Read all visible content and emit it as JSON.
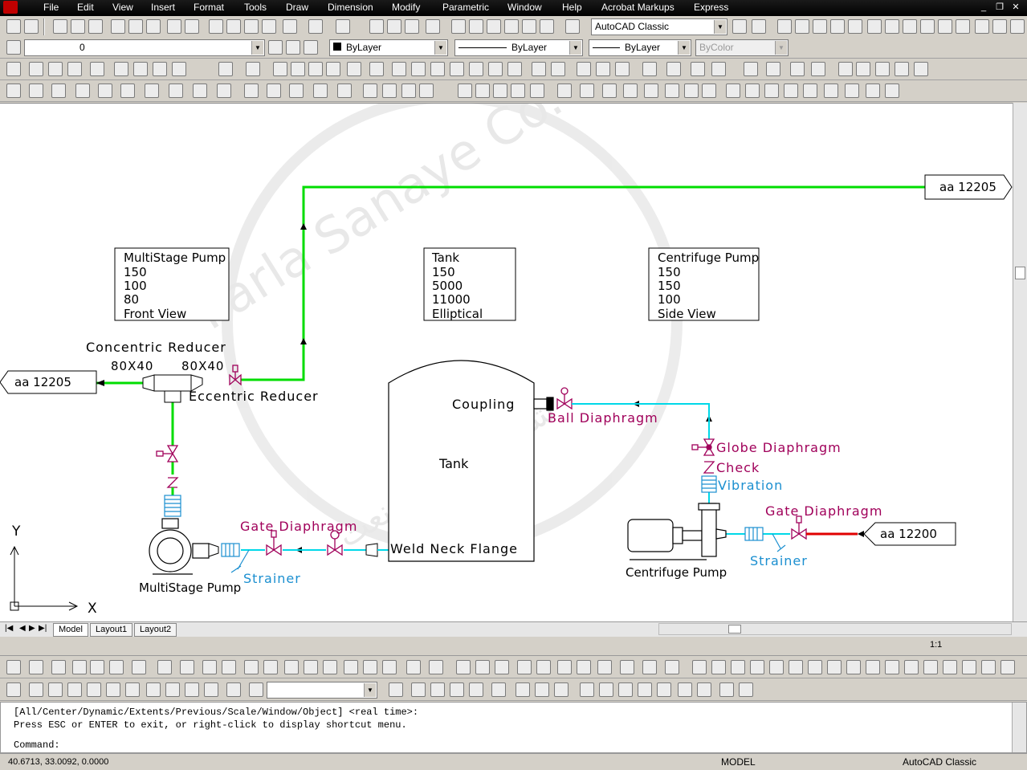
{
  "menubar": {
    "items": [
      "File",
      "Edit",
      "View",
      "Insert",
      "Format",
      "Tools",
      "Draw",
      "Dimension",
      "Modify",
      "Parametric",
      "Window",
      "Help",
      "Acrobat Markups",
      "Express"
    ]
  },
  "toolbar1": {
    "workspace_combo": "AutoCAD Classic"
  },
  "toolbar2": {
    "layer_combo": "0",
    "color_combo": "ByLayer",
    "linetype_combo": "ByLayer",
    "lineweight_combo": "ByLayer",
    "plotstyle_combo": "ByColor"
  },
  "drawing": {
    "offpage_top_right": "aa 12205",
    "offpage_left": "aa 12205",
    "offpage_right": "aa 12200",
    "multistage_box": {
      "lines": [
        "MultiStage Pump",
        "150",
        "100",
        "80",
        "Front View"
      ]
    },
    "tank_box": {
      "lines": [
        "Tank",
        "150",
        "5000",
        "11000",
        "Elliptical"
      ]
    },
    "centrifuge_box": {
      "lines": [
        "Centrifuge Pump",
        "150",
        "150",
        "100",
        "Side View"
      ]
    },
    "labels": {
      "concentric_reducer": "Concentric  Reducer",
      "size_left": "80X40",
      "size_right": "80X40",
      "eccentric_reducer": "Eccentric  Reducer",
      "coupling": "Coupling",
      "tank": "Tank",
      "weld_neck_flange": "Weld  Neck  Flange",
      "ball_diaphragm": "Ball  Diaphragm",
      "globe_diaphragm": "Globe  Diaphragm",
      "check": "Check",
      "vibration": "Vibration",
      "gate_diaphragm_right": "Gate  Diaphragm",
      "strainer_right": "Strainer",
      "centrifuge_pump": "Centrifuge Pump",
      "gate_diaphragm_left": "Gate  Diaphragm",
      "strainer_left": "Strainer",
      "multistage_pump": "MultiStage Pump",
      "axis_y": "Y",
      "axis_x": "X"
    },
    "watermark": {
      "text": "Parla Sanaye Co.",
      "text_fa": "شرکت پارلا صنعت"
    }
  },
  "layout_tabs": {
    "tabs": [
      "Model",
      "Layout1",
      "Layout2"
    ],
    "active": "Model"
  },
  "annotation": {
    "scale": "1:1"
  },
  "command": {
    "line1": "[All/Center/Dynamic/Extents/Previous/Scale/Window/Object] <real time>:",
    "line2": "Press ESC or ENTER to exit, or right-click to display shortcut menu.",
    "prompt": "Command:"
  },
  "status": {
    "coords": "40.6713, 33.0092, 0.0000",
    "space": "MODEL",
    "workspace": "AutoCAD Classic"
  },
  "colors": {
    "pipe_green": "#00dd00",
    "pipe_cyan": "#00d8e8",
    "pipe_red": "#e00000",
    "valve_magenta": "#a0005a",
    "label_blue": "#1b8fd0"
  }
}
